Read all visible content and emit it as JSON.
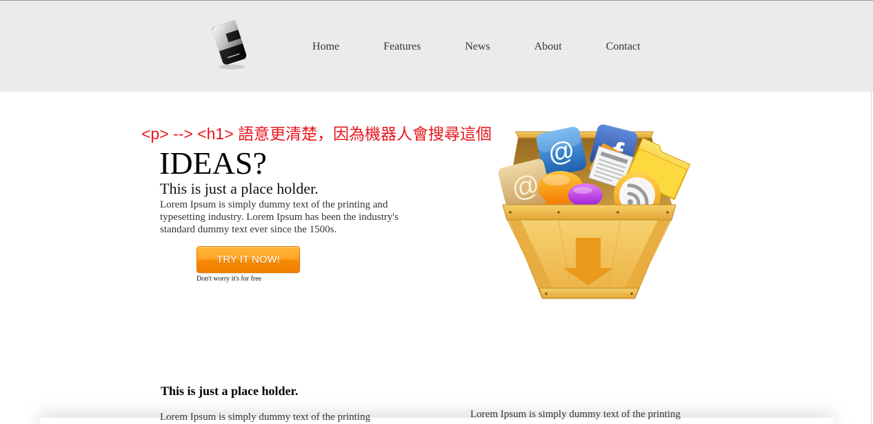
{
  "page": {
    "header_bg": "#ebebeb",
    "text_color": "#333333",
    "annotation_color": "#e8141b",
    "cta_top_color": "#ffb63c",
    "cta_bottom_color": "#f07c00"
  },
  "header": {
    "logo_icon": "logo-icon",
    "nav": [
      {
        "label": "Home"
      },
      {
        "label": "Features"
      },
      {
        "label": "News"
      },
      {
        "label": "About"
      },
      {
        "label": "Contact"
      }
    ]
  },
  "annotation": {
    "text": "<p> --> <h1> 語意更清楚，因為機器人會搜尋這個"
  },
  "hero": {
    "title": "IDEAS?",
    "subtitle": "This is just a place holder.",
    "body": "Lorem Ipsum is simply dummy text of the printing and typesetting industry. Lorem Ipsum has been the industry's standard dummy text ever since the 1500s.",
    "cta": {
      "label": "TRY IT NOW!",
      "note": "Don't worry it's for free"
    },
    "illustration": {
      "icons": [
        "crate-icon",
        "email-icon",
        "facebook-icon",
        "folder-icon",
        "newspaper-icon",
        "chat-bubble-icon",
        "rss-icon",
        "down-arrow-icon"
      ],
      "email_glyph": "@",
      "facebook_glyph": "f"
    }
  },
  "section": {
    "heading": "This is just a place holder.",
    "columns": [
      {
        "text": "Lorem Ipsum is simply dummy text of the printing"
      },
      {
        "text": "Lorem Ipsum is simply dummy text of the printing"
      }
    ]
  }
}
